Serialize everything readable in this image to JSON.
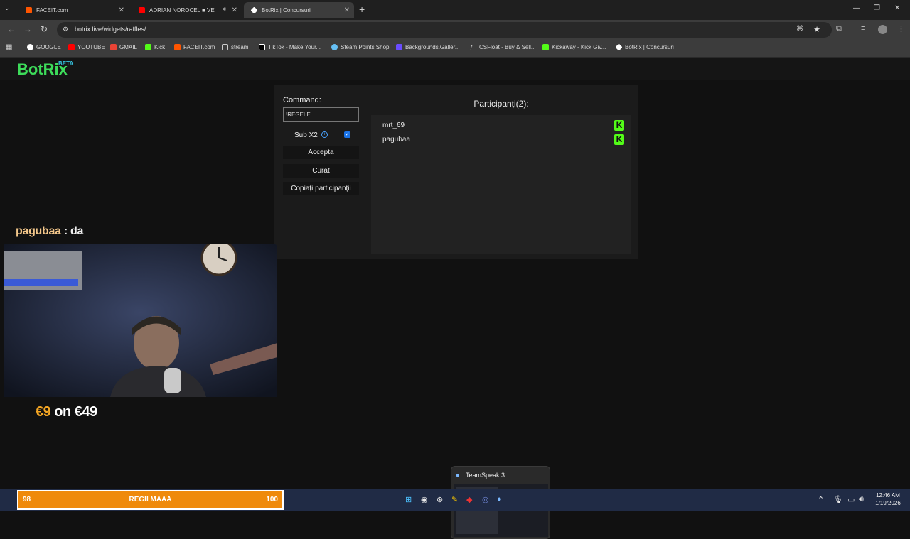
{
  "browser": {
    "tabs": [
      {
        "title": "FACEIT.com",
        "active": false,
        "favicon_color": "#ff5500"
      },
      {
        "title": "ADRIAN NOROCEL ■ VE",
        "active": false,
        "favicon_color": "#ff0000"
      },
      {
        "title": "BotRix | Concursuri",
        "active": true,
        "favicon_color": "#ffffff"
      }
    ],
    "new_tab": "+",
    "url": "botrix.live/widgets/raffles/",
    "bookmarks": [
      "GOOGLE",
      "YOUTUBE",
      "GMAIL",
      "Kick",
      "FACEIT.com",
      "stream",
      "TikTok - Make Your...",
      "Steam Points Shop",
      "Backgrounds.Galler...",
      "CSFloat - Buy & Sell...",
      "Kickaway - Kick Giv...",
      "BotRix | Concursuri"
    ]
  },
  "app": {
    "logo": "BotRix",
    "logo_badge": "BETA"
  },
  "raffle": {
    "command_label": "Command:",
    "command_value": "!REGELE",
    "sub_label": "Sub X2",
    "sub_checked": true,
    "buttons": {
      "accept": "Accepta",
      "clear": "Curat",
      "copy": "Copiați participanții"
    },
    "participants_title": "Participanți(2):",
    "participants": [
      {
        "name": "mrt_69",
        "platform": "kick"
      },
      {
        "name": "pagubaa",
        "platform": "kick"
      }
    ]
  },
  "overlay": {
    "chat_user": "pagubaa",
    "chat_text": " : da",
    "goal_current": "€9",
    "goal_rest": " on €49"
  },
  "taskbar_preview": {
    "title": "TeamSpeak 3"
  },
  "subgoal": {
    "current": "98",
    "label": "REGII MAAA",
    "target": "100"
  },
  "clock": {
    "time": "12:46 AM",
    "date": "1/19/2026"
  }
}
